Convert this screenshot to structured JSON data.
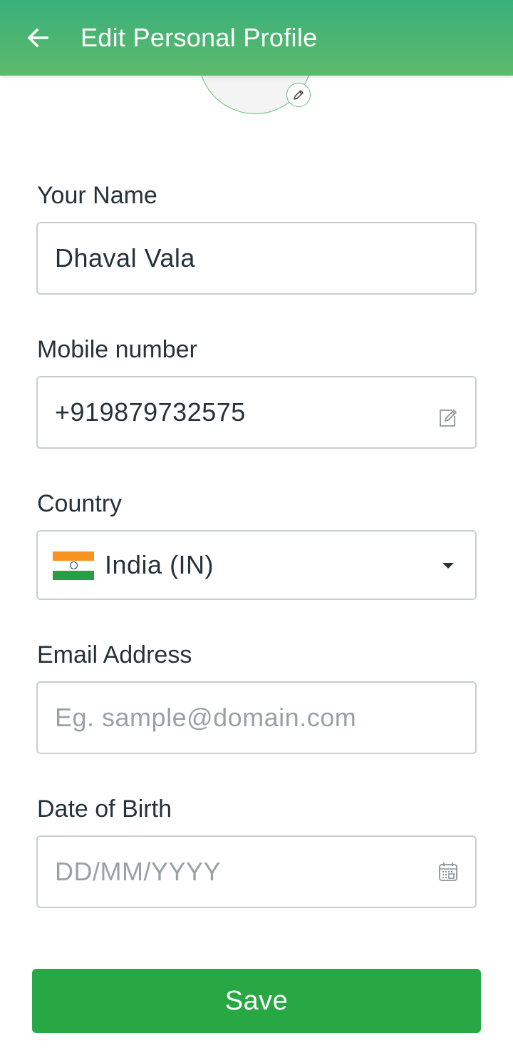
{
  "header": {
    "title": "Edit Personal Profile",
    "back_icon": "arrow-left-icon",
    "background_colors": [
      "#39b07a",
      "#5dba6b"
    ]
  },
  "avatar": {
    "edit_icon": "pencil-icon"
  },
  "form": {
    "name": {
      "label": "Your Name",
      "value": "Dhaval Vala"
    },
    "mobile": {
      "label": "Mobile number",
      "value": "+919879732575",
      "icon": "edit-icon"
    },
    "country": {
      "label": "Country",
      "value": "India (IN)",
      "flag_icon": "india-flag-icon",
      "dropdown_icon": "caret-down-icon"
    },
    "email": {
      "label": "Email Address",
      "value": "",
      "placeholder": "Eg. sample@domain.com"
    },
    "dob": {
      "label": "Date of Birth",
      "value": "",
      "placeholder": "DD/MM/YYYY",
      "icon": "calendar-icon"
    }
  },
  "actions": {
    "save_label": "Save",
    "save_color": "#28a745"
  }
}
